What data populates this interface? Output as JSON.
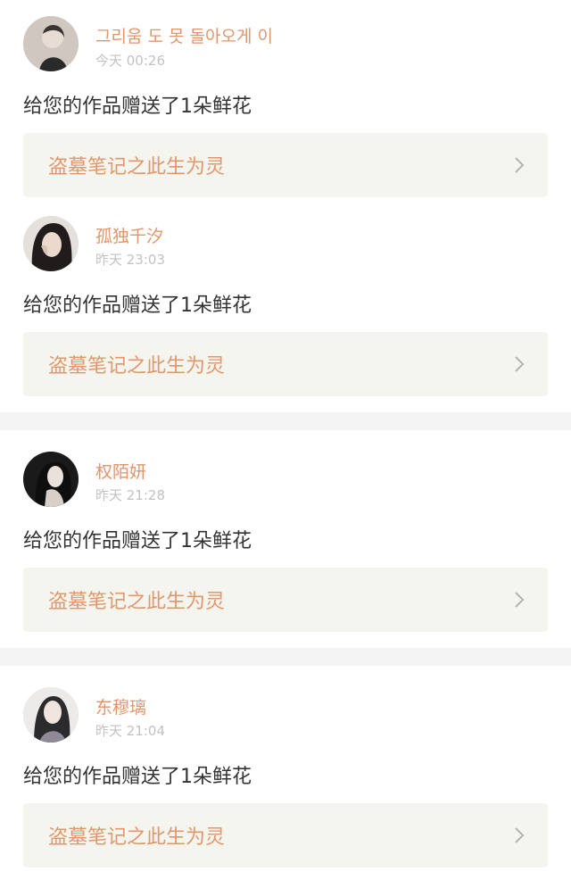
{
  "notifications": [
    {
      "username": "그리움 도 못 돌아오게 이",
      "time": "今天 00:26",
      "message": "给您的作品赠送了1朵鲜花",
      "work_title": "盗墓笔记之此生为灵",
      "avatar_icon": "user-avatar"
    },
    {
      "username": "孤独千汐",
      "time": "昨天 23:03",
      "message": "给您的作品赠送了1朵鲜花",
      "work_title": "盗墓笔记之此生为灵",
      "avatar_icon": "user-avatar"
    },
    {
      "username": "权陌妍",
      "time": "昨天 21:28",
      "message": "给您的作品赠送了1朵鲜花",
      "work_title": "盗墓笔记之此生为灵",
      "avatar_icon": "user-avatar"
    },
    {
      "username": "东穆璃",
      "time": "昨天 21:04",
      "message": "给您的作品赠送了1朵鲜花",
      "work_title": "盗墓笔记之此生为灵",
      "avatar_icon": "user-avatar"
    }
  ],
  "colors": {
    "username": "#e0956a",
    "time": "#c2c2c2",
    "message": "#333333",
    "work_title": "#e2966b",
    "work_link_bg": "#f5f5ef",
    "separator": "#f4f4f4"
  },
  "icons": {
    "chevron": "chevron-right-icon"
  }
}
